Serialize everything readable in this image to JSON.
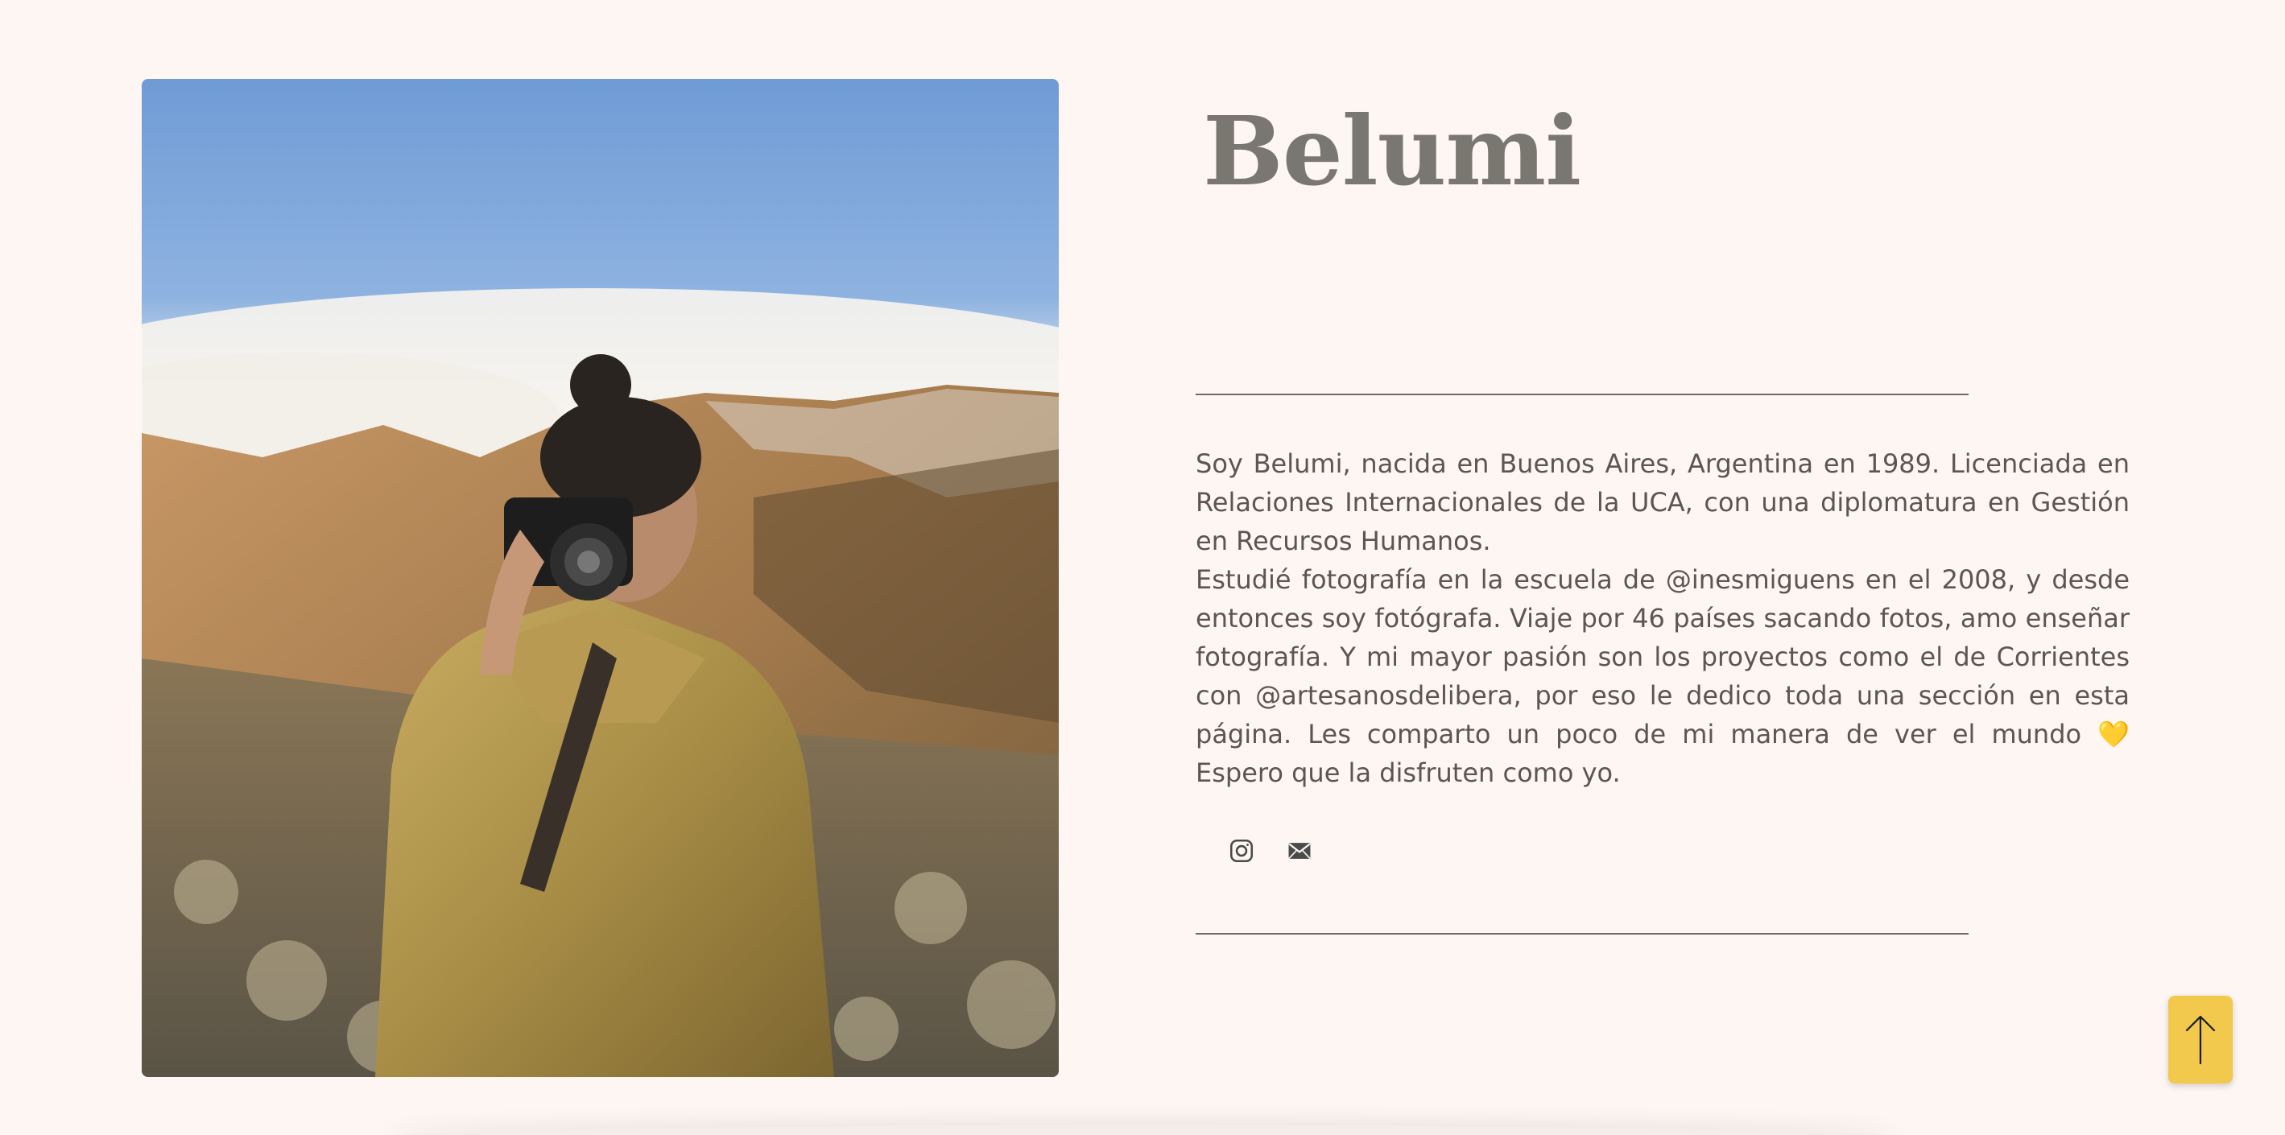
{
  "profile": {
    "name": "Belumi",
    "bio_paragraph_1": "Soy Belumi, nacida en Buenos Aires, Argentina en 1989. Licenciada en Relaciones Internacionales de la UCA, con una diplomatura en Gestión en Recursos Humanos.",
    "bio_paragraph_2": "Estudié fotografía en la escuela de @inesmiguens en el 2008, y desde entonces soy fotógrafa. Viaje por 46 países sacando fotos, amo enseñar fotografía. Y mi mayor pasión son los proyectos como el de Corrientes con @artesanosdelibera, por eso le dedico toda una sección en esta página. Les comparto un poco de mi manera de ver el mundo 💛 Espero que la disfruten como yo."
  },
  "social": {
    "icons": [
      "instagram-icon",
      "mail-icon"
    ]
  },
  "back_to_top": {
    "icon": "arrow-up-icon"
  },
  "colors": {
    "background": "#fdf6f2",
    "title": "#7a7670",
    "text": "#5a5650",
    "accent": "#f2c94c"
  }
}
